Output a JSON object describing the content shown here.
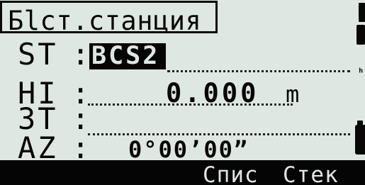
{
  "screen": {
    "title": "Бlст.станция",
    "background_color": "#dfe7e2",
    "text_color": "#050505"
  },
  "fields": [
    {
      "label": "ST",
      "colon": ":",
      "value": "BCS2"
    },
    {
      "label": "HI",
      "colon": ":",
      "value": "0.000",
      "unit": "m"
    },
    {
      "label": "ЗT",
      "colon": ":",
      "value": ""
    },
    {
      "label": "AZ",
      "colon": ":",
      "value": "0°00’00”"
    }
  ],
  "softkeys": [
    {
      "label": "Спис"
    },
    {
      "label": "Стек"
    }
  ],
  "status_icons": [
    {
      "name": "top-status-icon"
    },
    {
      "name": "battery-icon"
    },
    {
      "name": "mode-glyph"
    }
  ]
}
